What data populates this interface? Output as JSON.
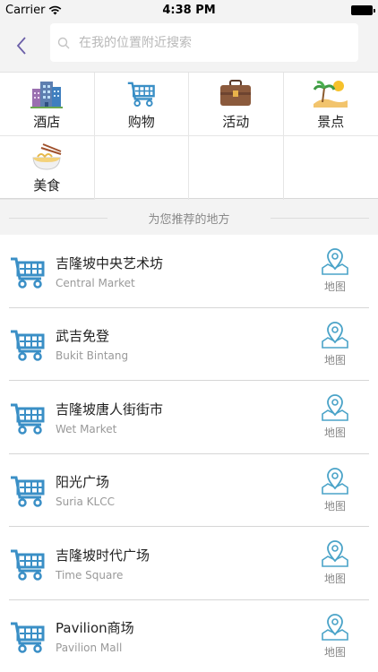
{
  "status": {
    "carrier": "Carrier",
    "time": "4:38 PM"
  },
  "search": {
    "placeholder": "在我的位置附近搜索"
  },
  "categories": [
    {
      "label": "酒店",
      "icon": "hotel-icon"
    },
    {
      "label": "购物",
      "icon": "shopping-cart-icon"
    },
    {
      "label": "活动",
      "icon": "briefcase-icon"
    },
    {
      "label": "景点",
      "icon": "beach-icon"
    },
    {
      "label": "美食",
      "icon": "noodles-icon"
    }
  ],
  "recommend": {
    "title": "为您推荐的地方"
  },
  "places": [
    {
      "name": "吉隆坡中央艺术坊",
      "sub": "Central Market",
      "map_label": "地图"
    },
    {
      "name": "武吉免登",
      "sub": "Bukit Bintang",
      "map_label": "地图"
    },
    {
      "name": "吉隆坡唐人街街市",
      "sub": "Wet Market",
      "map_label": "地图"
    },
    {
      "name": "阳光广场",
      "sub": "Suria KLCC",
      "map_label": "地图"
    },
    {
      "name": "吉隆坡时代广场",
      "sub": "Time Square",
      "map_label": "地图"
    },
    {
      "name": "Pavilion商场",
      "sub": "Pavilion Mall",
      "map_label": "地图"
    }
  ],
  "colors": {
    "accent": "#3a8fc6",
    "back": "#6b5fa8",
    "map": "#4aa3c8"
  }
}
